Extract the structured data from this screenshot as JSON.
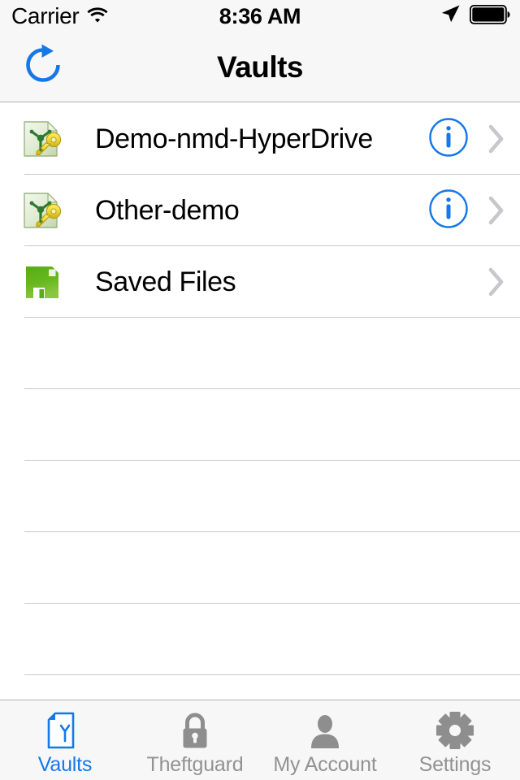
{
  "status_bar": {
    "carrier": "Carrier",
    "wifi_icon": "wifi-icon",
    "time": "8:36 AM",
    "location_icon": "location-arrow-icon",
    "battery_icon": "battery-full-icon"
  },
  "nav_bar": {
    "title": "Vaults",
    "refresh_icon": "refresh-icon",
    "accent_color": "#1678e8"
  },
  "list": {
    "rows": [
      {
        "label": "Demo-nmd-HyperDrive",
        "icon": "vault-key-document-icon",
        "has_info": true,
        "has_chevron": true
      },
      {
        "label": "Other-demo",
        "icon": "vault-key-document-icon",
        "has_info": true,
        "has_chevron": true
      },
      {
        "label": "Saved Files",
        "icon": "floppy-disk-icon",
        "has_info": false,
        "has_chevron": true
      }
    ],
    "empty_row_count": 6,
    "separator_color": "#c8c7cc"
  },
  "tab_bar": {
    "tabs": [
      {
        "label": "Vaults",
        "icon": "vault-document-icon",
        "active": true
      },
      {
        "label": "Theftguard",
        "icon": "padlock-icon",
        "active": false
      },
      {
        "label": "My Account",
        "icon": "person-icon",
        "active": false
      },
      {
        "label": "Settings",
        "icon": "gear-icon",
        "active": false
      }
    ],
    "active_color": "#1678e8",
    "inactive_color": "#929292"
  }
}
